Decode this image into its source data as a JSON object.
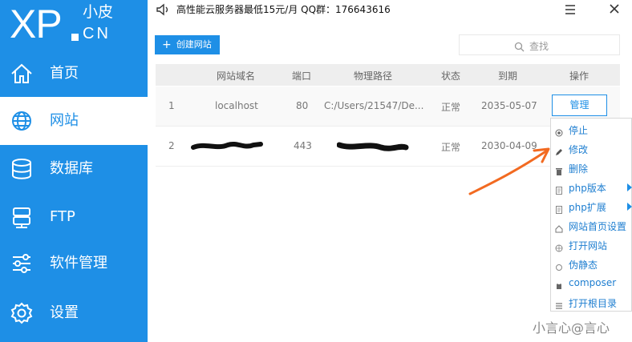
{
  "logo": {
    "main": "XP",
    "cn": "小皮",
    "en": "CN"
  },
  "nav": [
    {
      "label": "首页",
      "icon": "home-icon",
      "active": false
    },
    {
      "label": "网站",
      "icon": "globe-icon",
      "active": true
    },
    {
      "label": "数据库",
      "icon": "database-icon",
      "active": false
    },
    {
      "label": "FTP",
      "icon": "server-icon",
      "active": false
    },
    {
      "label": "软件管理",
      "icon": "sliders-icon",
      "active": false
    },
    {
      "label": "设置",
      "icon": "gear-icon",
      "active": false
    }
  ],
  "topbar": {
    "notice": "高性能云服务器最低15元/月   QQ群：176643616"
  },
  "toolbar": {
    "create_label": "创建网站",
    "search_placeholder": "查找"
  },
  "table": {
    "headers": [
      "网站域名",
      "端口",
      "物理路径",
      "状态",
      "到期",
      "操作"
    ],
    "rows": [
      {
        "index": "1",
        "domain": "localhost",
        "port": "80",
        "path": "C:/Users/21547/De...",
        "status": "正常",
        "expire": "2035-05-07",
        "action": "管理"
      },
      {
        "index": "2",
        "domain": "",
        "port": "443",
        "path": "",
        "status": "正常",
        "expire": "2030-04-09",
        "action": ""
      }
    ]
  },
  "context_menu": [
    {
      "label": "停止",
      "icon": "stop-icon",
      "submenu": false
    },
    {
      "label": "修改",
      "icon": "pencil-icon",
      "submenu": false
    },
    {
      "label": "删除",
      "icon": "trash-icon",
      "submenu": false
    },
    {
      "label": "php版本",
      "icon": "file-icon",
      "submenu": true
    },
    {
      "label": "php扩展",
      "icon": "file-icon",
      "submenu": true
    },
    {
      "label": "网站首页设置",
      "icon": "home-icon",
      "submenu": false
    },
    {
      "label": "打开网站",
      "icon": "globe-icon",
      "submenu": false
    },
    {
      "label": "伪静态",
      "icon": "refresh-icon",
      "submenu": false
    },
    {
      "label": "composer",
      "icon": "composer-icon",
      "submenu": false
    },
    {
      "label": "打开根目录",
      "icon": "list-icon",
      "submenu": false
    }
  ],
  "watermark": "小言心@言心",
  "colors": {
    "accent": "#1e8fe6",
    "annotation": "#f26a21"
  }
}
